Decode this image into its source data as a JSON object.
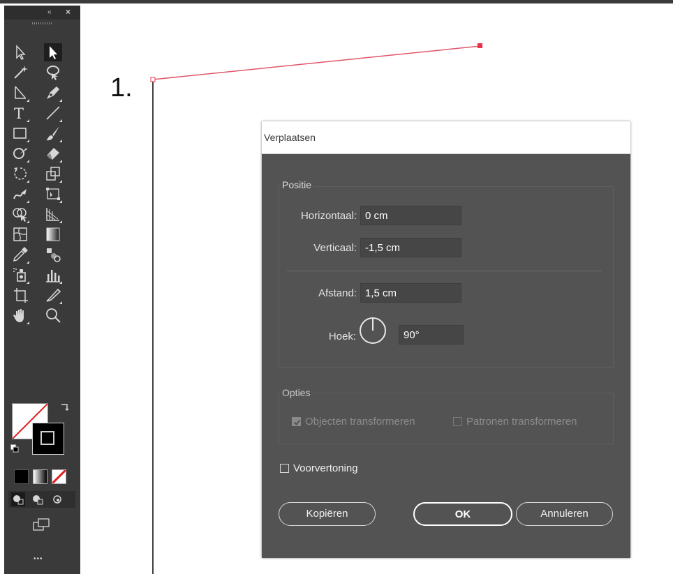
{
  "canvas": {
    "step_label": "1."
  },
  "toolbar": {
    "collapse_glyph": "«",
    "close_glyph": "×",
    "more_glyph": "•••",
    "tools": [
      "selection-tool",
      "direct-selection-tool",
      "magic-wand-tool",
      "lasso-tool",
      "pen-tool-variant",
      "pen-tool",
      "type-tool",
      "line-segment-tool",
      "rectangle-tool",
      "paintbrush-tool",
      "shaper-tool",
      "eraser-tool",
      "rotate-tool",
      "scale-tool",
      "warp-tool",
      "free-transform-tool",
      "shape-builder-tool",
      "perspective-grid-tool",
      "mesh-tool",
      "gradient-tool",
      "eyedropper-tool",
      "blend-tool",
      "symbol-sprayer-tool",
      "column-graph-tool",
      "artboard-tool",
      "slice-tool",
      "hand-tool",
      "zoom-tool"
    ]
  },
  "dialog": {
    "title": "Verplaatsen",
    "position_group": {
      "legend": "Positie",
      "horizontal_label": "Horizontaal:",
      "horizontal_value": "0 cm",
      "vertical_label": "Verticaal:",
      "vertical_value": "-1,5 cm",
      "distance_label": "Afstand:",
      "distance_value": "1,5 cm",
      "angle_label": "Hoek:",
      "angle_value": "90°"
    },
    "options_group": {
      "legend": "Opties",
      "transform_objects_label": "Objecten transformeren",
      "transform_objects_checked": true,
      "transform_patterns_label": "Patronen transformeren",
      "transform_patterns_checked": false
    },
    "preview_label": "Voorvertoning",
    "preview_checked": false,
    "buttons": {
      "copy": "Kopiëren",
      "ok": "OK",
      "cancel": "Annuleren"
    }
  },
  "colors": {
    "dialog_bg": "#535353",
    "toolbar_bg": "#3a3a3a",
    "path_stroke": "#e0566a",
    "anchor": "#e8334a"
  }
}
